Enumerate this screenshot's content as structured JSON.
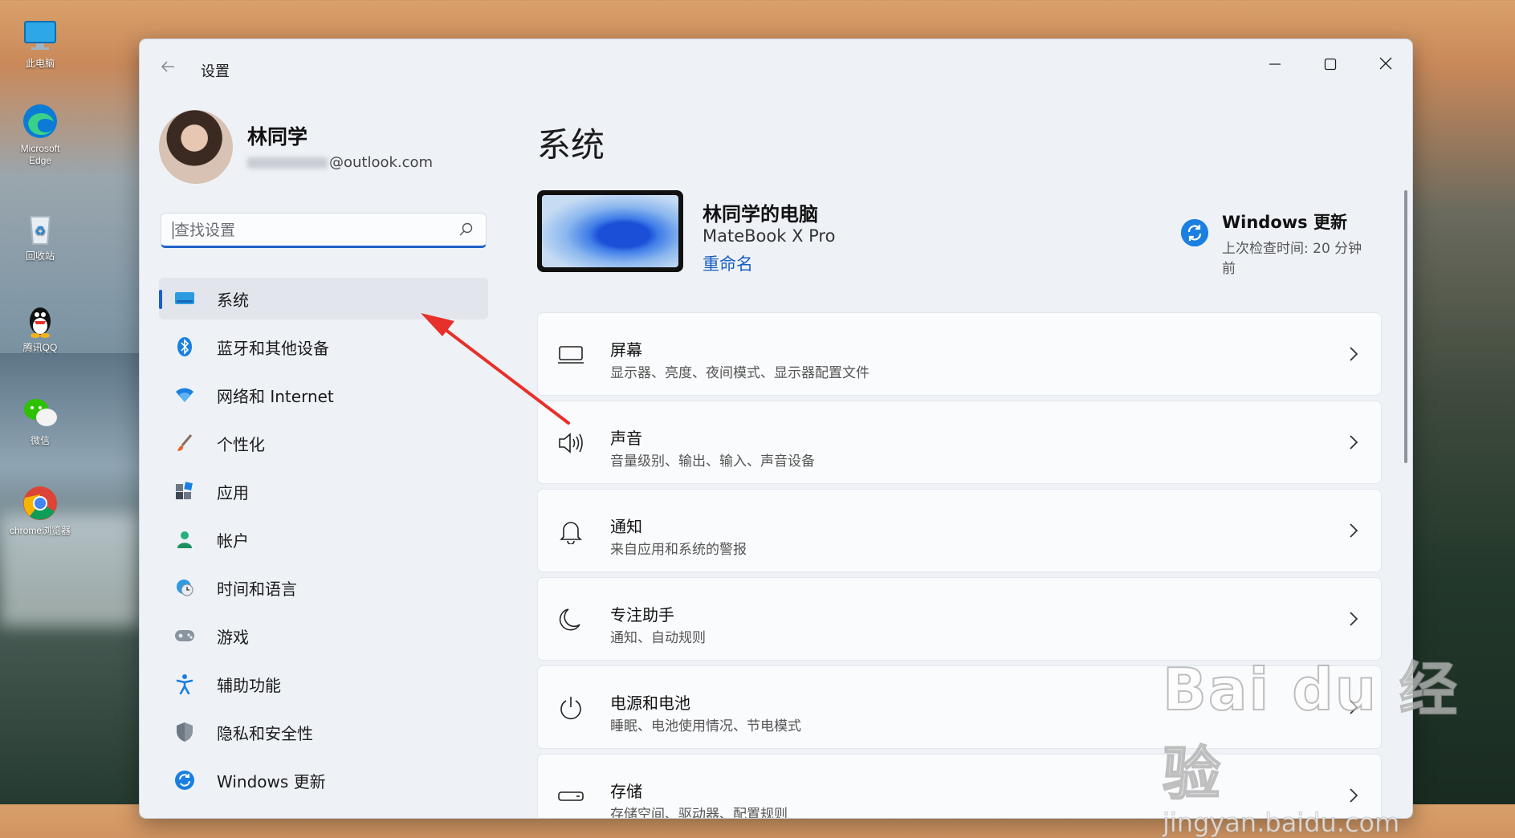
{
  "desktop": {
    "icons": [
      {
        "label": "此电脑",
        "icon": "computer-icon"
      },
      {
        "label": "Microsoft Edge",
        "icon": "edge-icon"
      },
      {
        "label": "回收站",
        "icon": "recycle-bin-icon"
      },
      {
        "label": "腾讯QQ",
        "icon": "qq-icon"
      },
      {
        "label": "微信",
        "icon": "wechat-icon"
      },
      {
        "label": "chrome浏览器",
        "icon": "chrome-icon"
      }
    ]
  },
  "window": {
    "title": "设置",
    "controls": {
      "minimize": "—",
      "maximize": "☐",
      "close": "✕"
    }
  },
  "profile": {
    "name": "林同学",
    "email_suffix": "@outlook.com"
  },
  "search": {
    "placeholder": "查找设置"
  },
  "sidebar": {
    "items": [
      {
        "label": "系统",
        "icon": "monitor-icon",
        "active": true
      },
      {
        "label": "蓝牙和其他设备",
        "icon": "bluetooth-icon"
      },
      {
        "label": "网络和 Internet",
        "icon": "wifi-icon"
      },
      {
        "label": "个性化",
        "icon": "brush-icon"
      },
      {
        "label": "应用",
        "icon": "apps-icon"
      },
      {
        "label": "帐户",
        "icon": "person-icon"
      },
      {
        "label": "时间和语言",
        "icon": "globe-clock-icon"
      },
      {
        "label": "游戏",
        "icon": "gamepad-icon"
      },
      {
        "label": "辅助功能",
        "icon": "accessibility-icon"
      },
      {
        "label": "隐私和安全性",
        "icon": "shield-icon"
      },
      {
        "label": "Windows 更新",
        "icon": "update-icon"
      }
    ]
  },
  "main": {
    "title": "系统",
    "device": {
      "name": "林同学的电脑",
      "model": "MateBook X Pro",
      "rename": "重命名"
    },
    "update": {
      "title": "Windows 更新",
      "subtitle": "上次检查时间: 20 分钟前"
    },
    "settings": [
      {
        "title": "屏幕",
        "subtitle": "显示器、亮度、夜间模式、显示器配置文件",
        "icon": "display-icon"
      },
      {
        "title": "声音",
        "subtitle": "音量级别、输出、输入、声音设备",
        "icon": "speaker-icon"
      },
      {
        "title": "通知",
        "subtitle": "来自应用和系统的警报",
        "icon": "bell-icon"
      },
      {
        "title": "专注助手",
        "subtitle": "通知、自动规则",
        "icon": "moon-icon"
      },
      {
        "title": "电源和电池",
        "subtitle": "睡眠、电池使用情况、节电模式",
        "icon": "power-icon"
      },
      {
        "title": "存储",
        "subtitle": "存储空间、驱动器、配置规则",
        "icon": "storage-icon"
      }
    ]
  },
  "watermark": {
    "main": "Bai du 经验",
    "url": "jingyan.baidu.com"
  },
  "colors": {
    "accent": "#1a5fc4",
    "annotation": "#e8302a"
  }
}
